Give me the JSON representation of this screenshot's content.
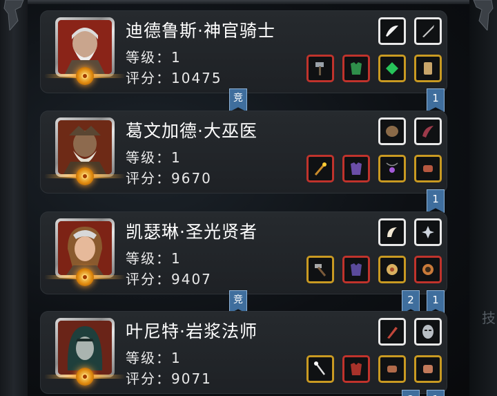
{
  "heroes": [
    {
      "name": "迪德鲁斯·神官骑士",
      "level": "等级：1",
      "score": "评分：10475"
    },
    {
      "name": "葛文加德·大巫医",
      "level": "等级：1",
      "score": "评分：9670"
    },
    {
      "name": "凯瑟琳·圣光贤者",
      "level": "等级：1",
      "score": "评分：9407"
    },
    {
      "name": "叶尼特·岩浆法师",
      "level": "等级：1",
      "score": "评分：9071"
    }
  ],
  "tags": {
    "comp": "竞",
    "one": "1",
    "two": "2"
  },
  "side_text": "技",
  "colors": {
    "white_rarity": "#e9e9e9",
    "gold_rarity": "#c99a22",
    "red_rarity": "#c0332c",
    "tag_blue": "#3f6e9d"
  }
}
